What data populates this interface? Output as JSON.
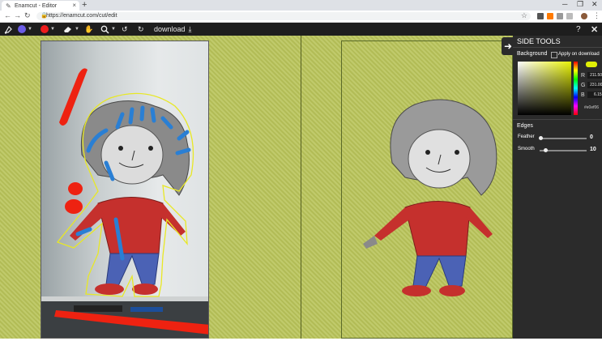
{
  "browser": {
    "tab_title": "Enamcut - Editor",
    "new_tab": "+",
    "url": "https://enamcut.com/cut/edit"
  },
  "toolbar": {
    "download_label": "download",
    "colors": {
      "brush_primary": "#6b5ce7",
      "brush_secondary": "#ee1c1c"
    }
  },
  "panel": {
    "title": "SIDE TOOLS",
    "background_label": "Background",
    "apply_on_download": "Apply on download",
    "rgb": {
      "r_label": "R",
      "r": "211.50",
      "g_label": "G",
      "g": "231.00",
      "b_label": "B",
      "b": "6.15"
    },
    "hex": "#e0ef06",
    "hex_text": "#e0ef06",
    "edges_label": "Edges",
    "feather_label": "Feather",
    "feather_value": "0",
    "smooth_label": "Smooth",
    "smooth_value": "10"
  },
  "colors": {
    "canvas_bg": "#b9c45a",
    "panel_bg": "#2b2b2b",
    "outline": "#e8e825",
    "marker_red": "#ee2211",
    "marker_blue": "#2a7fd4"
  }
}
